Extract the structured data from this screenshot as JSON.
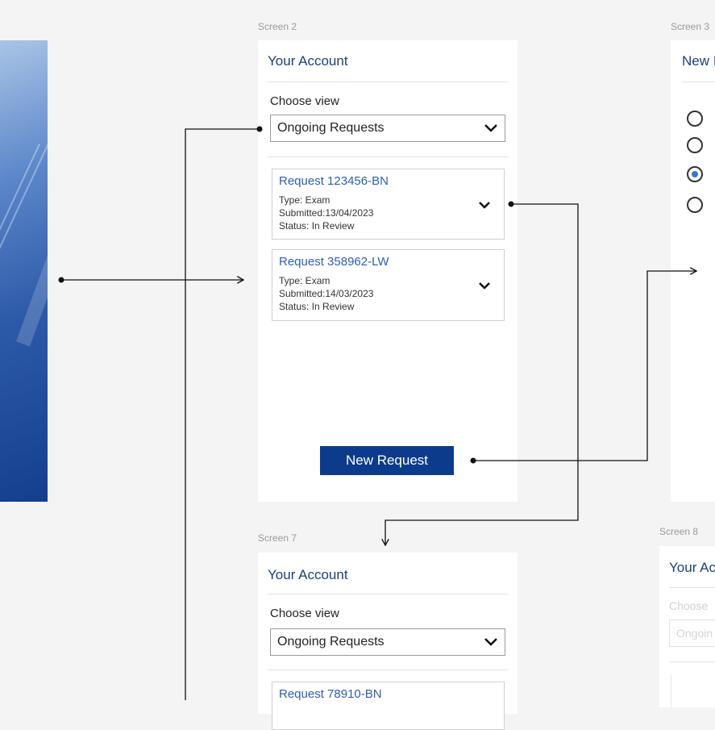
{
  "screens": {
    "s2": {
      "label": "Screen 2",
      "title": "Your Account",
      "choose_label": "Choose view",
      "select_value": "Ongoing Requests",
      "requests": [
        {
          "title": "Request 123456-BN",
          "type": "Type: Exam",
          "submitted": "Submitted:13/04/2023",
          "status": "Status: In Review"
        },
        {
          "title": "Request 358962-LW",
          "type": "Type: Exam",
          "submitted": "Submitted:14/03/2023",
          "status": "Status: In Review"
        }
      ],
      "new_request_label": "New Request"
    },
    "s3": {
      "label": "Screen 3",
      "title": "New I",
      "radios": [
        {
          "checked": false
        },
        {
          "checked": false
        },
        {
          "checked": true
        },
        {
          "checked": false
        }
      ]
    },
    "s7": {
      "label": "Screen 7",
      "title": "Your Account",
      "choose_label": "Choose view",
      "select_value": "Ongoing Requests",
      "requests": [
        {
          "title": "Request 78910-BN"
        }
      ]
    },
    "s8": {
      "label": "Screen 8",
      "title": "Your Ac",
      "choose_label": "Choose",
      "select_value": "Ongoin"
    }
  },
  "colors": {
    "background": "#f4f4f4",
    "title_blue": "#1b3f7a",
    "link_blue": "#2d5db4",
    "button_navy": "#0d3b8c",
    "radio_blue": "#2d7be0"
  }
}
